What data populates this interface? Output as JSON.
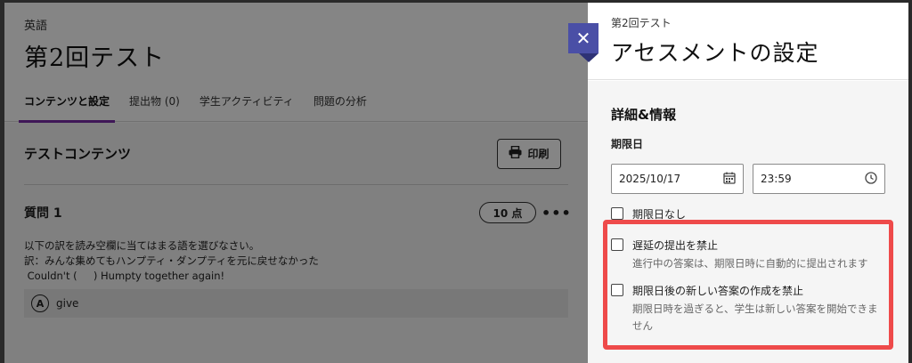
{
  "page": {
    "course_name": "英語",
    "test_title": "第2回テスト",
    "tabs": [
      {
        "label": "コンテンツと設定"
      },
      {
        "label": "提出物 (0)"
      },
      {
        "label": "学生アクティビティ"
      },
      {
        "label": "問題の分析"
      }
    ],
    "section_title": "テストコンテンツ",
    "print_label": "印刷",
    "question": {
      "title": "質問 1",
      "points": "10 点",
      "more": "•••",
      "lines": [
        "以下の訳を読み空欄に当てはまる語を選びなさい。",
        "訳：みんな集めてもハンプティ・ダンプティを元に戻せなかった",
        " Couldn't (     ) Humpty together again!"
      ],
      "answer_letter": "A",
      "answer_text": "give"
    }
  },
  "panel": {
    "subtitle": "第2回テスト",
    "title": "アセスメントの設定",
    "details_title": "詳細&情報",
    "due_label": "期限日",
    "date_value": "2025/10/17",
    "time_value": "23:59",
    "no_due_label": "期限日なし",
    "late_label": "遅延の提出を禁止",
    "late_desc": "進行中の答案は、期限日時に自動的に提出されます",
    "new_label": "期限日後の新しい答案の作成を禁止",
    "new_desc": "期限日時を過ぎると、学生は新しい答案を開始できません"
  },
  "colors": {
    "accent": "#7a2ca8",
    "close_flag": "#4a4fa6",
    "highlight": "#ee4a4a"
  }
}
